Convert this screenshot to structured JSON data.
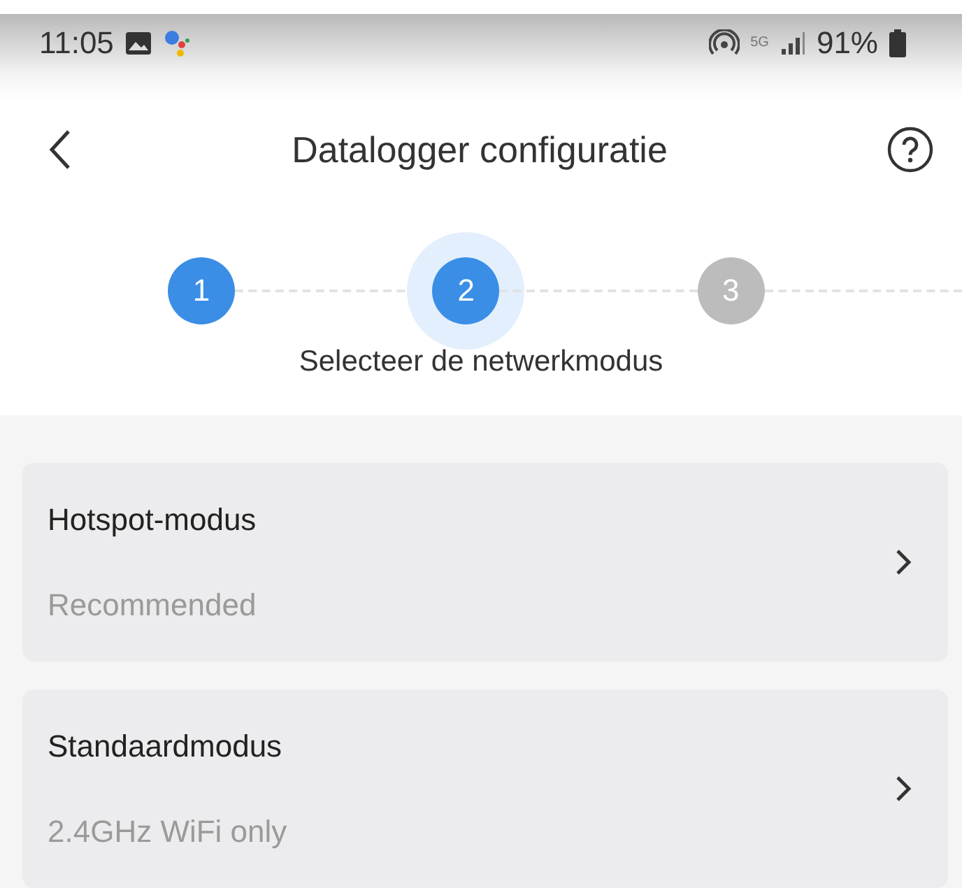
{
  "status_bar": {
    "time": "11:05",
    "network": "5G",
    "battery": "91%"
  },
  "header": {
    "title": "Datalogger configuratie"
  },
  "steps": [
    {
      "number": "1",
      "reached": true,
      "selected": false
    },
    {
      "number": "2",
      "reached": true,
      "selected": true
    },
    {
      "number": "3",
      "reached": false,
      "selected": false
    }
  ],
  "step_caption": "Selecteer de netwerkmodus",
  "modes": [
    {
      "title": "Hotspot-modus",
      "subtitle": "Recommended"
    },
    {
      "title": "Standaardmodus",
      "subtitle": "2.4GHz WiFi only"
    }
  ]
}
